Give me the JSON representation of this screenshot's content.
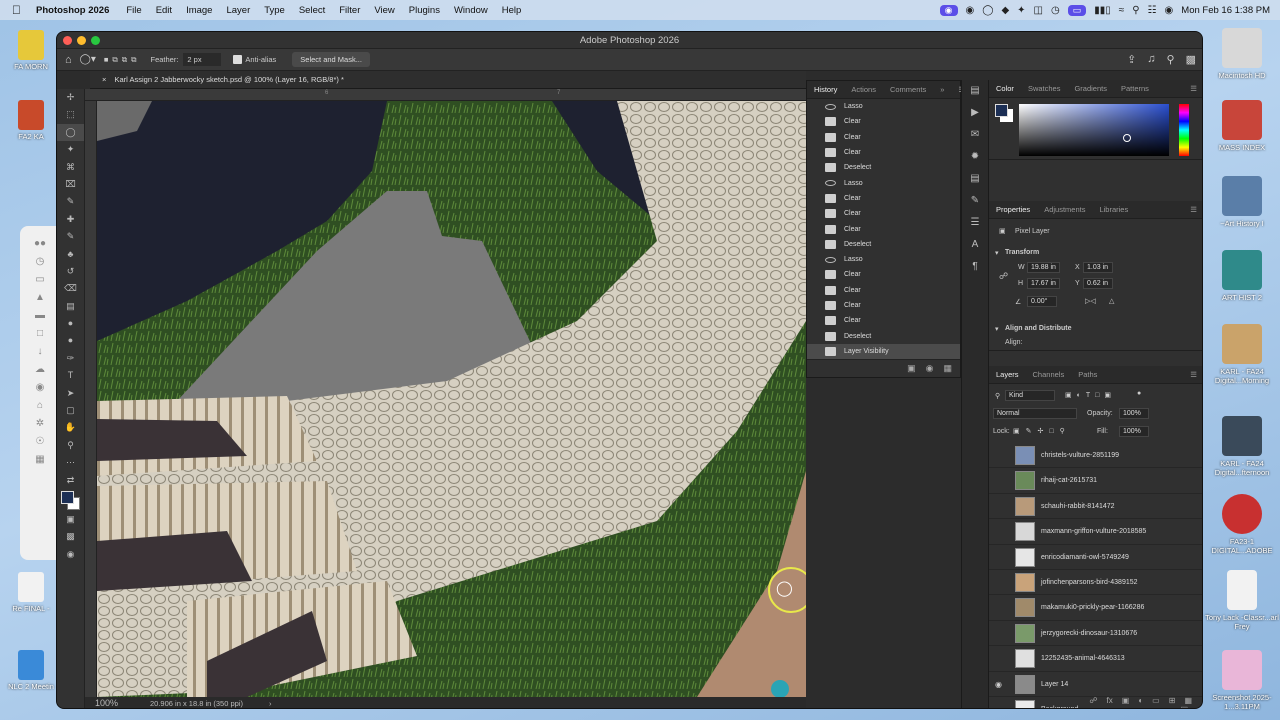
{
  "menubar": {
    "app_name": "Photoshop 2026",
    "items": [
      "File",
      "Edit",
      "Image",
      "Layer",
      "Type",
      "Select",
      "Filter",
      "View",
      "Plugins",
      "Window",
      "Help"
    ],
    "datetime": "Mon Feb 16  1:38 PM"
  },
  "window": {
    "title": "Adobe Photoshop 2026"
  },
  "options_bar": {
    "feather_label": "Feather:",
    "feather_value": "2 px",
    "antialias_label": "Anti-alias",
    "select_mask_label": "Select and Mask..."
  },
  "document": {
    "tab_title": "Karl Assign 2 Jabberwocky sketch.psd @ 100% (Layer 16, RGB/8*) *"
  },
  "status": {
    "zoom": "100%",
    "doc_info": "20.906 in x 18.8 in (350 ppi)"
  },
  "history": {
    "tabs": [
      "History",
      "Actions",
      "Comments"
    ],
    "items": [
      {
        "label": "Lasso",
        "icon": "lasso"
      },
      {
        "label": "Clear",
        "icon": "doc"
      },
      {
        "label": "Clear",
        "icon": "doc"
      },
      {
        "label": "Clear",
        "icon": "doc"
      },
      {
        "label": "Deselect",
        "icon": "doc"
      },
      {
        "label": "Lasso",
        "icon": "lasso"
      },
      {
        "label": "Clear",
        "icon": "doc"
      },
      {
        "label": "Clear",
        "icon": "doc"
      },
      {
        "label": "Clear",
        "icon": "doc"
      },
      {
        "label": "Deselect",
        "icon": "doc"
      },
      {
        "label": "Lasso",
        "icon": "lasso"
      },
      {
        "label": "Clear",
        "icon": "doc"
      },
      {
        "label": "Clear",
        "icon": "doc"
      },
      {
        "label": "Clear",
        "icon": "doc"
      },
      {
        "label": "Clear",
        "icon": "doc"
      },
      {
        "label": "Deselect",
        "icon": "doc"
      },
      {
        "label": "Layer Visibility",
        "icon": "doc"
      }
    ]
  },
  "color_panel": {
    "tabs": [
      "Color",
      "Swatches",
      "Gradients",
      "Patterns"
    ],
    "foreground": "#1c2f55"
  },
  "properties": {
    "tabs": [
      "Properties",
      "Adjustments",
      "Libraries"
    ],
    "type": "Pixel Layer",
    "transform_label": "Transform",
    "w_label": "W",
    "w": "19.88 in",
    "h_label": "H",
    "h": "17.67 in",
    "x_label": "X",
    "x": "1.03 in",
    "y_label": "Y",
    "y": "0.62 in",
    "angle": "0.00°",
    "align_label": "Align and Distribute",
    "align_sub": "Align:"
  },
  "layers_panel": {
    "tabs": [
      "Layers",
      "Channels",
      "Paths"
    ],
    "filter_kind": "Kind",
    "blend_mode": "Normal",
    "opacity_label": "Opacity:",
    "opacity": "100%",
    "lock_label": "Lock:",
    "fill_label": "Fill:",
    "fill": "100%",
    "layers": [
      {
        "name": "christels-vulture-2851199",
        "visible": false,
        "thumb": "#7a8fb5"
      },
      {
        "name": "rihaij-cat-2615731",
        "visible": false,
        "thumb": "#6a8a5a"
      },
      {
        "name": "schauhi-rabbit-8141472",
        "visible": false,
        "thumb": "#b89a7a"
      },
      {
        "name": "maxmann-griffon-vulture-2018585",
        "visible": false,
        "thumb": "#d8d8d8"
      },
      {
        "name": "enricodiamanti-owl-5749249",
        "visible": false,
        "thumb": "#e6e6e6"
      },
      {
        "name": "jofinchenparsons-bird-4389152",
        "visible": false,
        "thumb": "#c9a37a"
      },
      {
        "name": "makamuki0-prickly-pear-1166286",
        "visible": false,
        "thumb": "#a08a6a"
      },
      {
        "name": "jerzygorecki-dinosaur-1310676",
        "visible": false,
        "thumb": "#7a9a6a"
      },
      {
        "name": "12252435-animal-4646313",
        "visible": false,
        "thumb": "#e0e0e0"
      },
      {
        "name": "Layer 14",
        "visible": true,
        "thumb": "#8a8a8a"
      },
      {
        "name": "Background",
        "visible": false,
        "thumb": "#eaeaea"
      }
    ]
  },
  "desktop_right": [
    {
      "label": "Macintosh HD",
      "color": "#d8d8d8"
    },
    {
      "label": "MASS INDEX",
      "color": "#c8453a"
    },
    {
      "label": "~Art History I",
      "color": "#5a7ea8"
    },
    {
      "label": "ART HIST 2",
      "color": "#2f8a8a"
    },
    {
      "label": "KARL - FA24 Digital...Morning",
      "color": "#caa36a"
    },
    {
      "label": "KARL - FA24 Digital...fternoon",
      "color": "#3a4a5a"
    },
    {
      "label": "FA23-1 DIGITAL...ADOBE",
      "color": "#c83030"
    },
    {
      "label": "Tony Lack -Classr...arl Frey",
      "color": "#f2f2f2"
    },
    {
      "label": "Screenshot 2025-1...3.11PM",
      "color": "#e9b6d8"
    }
  ],
  "desktop_left": [
    {
      "label": "FA MORN",
      "color": "#e6c83a"
    },
    {
      "label": "FA2 KA",
      "color": "#c84a2a"
    },
    {
      "label": "Re FINAL -",
      "color": "#f2f2f2"
    },
    {
      "label": "NLC 2 Meetin",
      "color": "#3a8ad8"
    }
  ],
  "accent": "#31a8ff"
}
